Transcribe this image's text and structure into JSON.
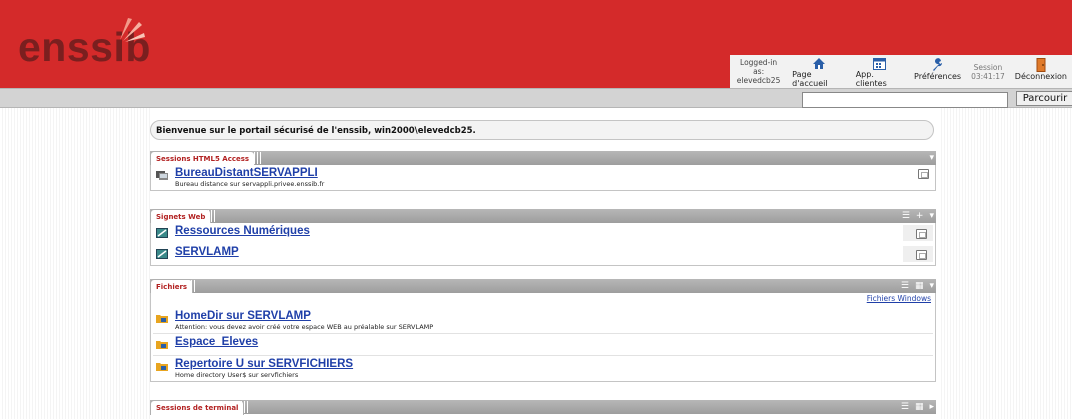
{
  "brand": {
    "logo_text": "enssib",
    "accent": "#d42a2a",
    "logo_color": "#7a1f1f"
  },
  "topnav": {
    "logged_in_label": "Logged-in as:",
    "username": "elevedcb25",
    "items": [
      {
        "label": "Page d'accueil",
        "icon": "home-icon"
      },
      {
        "label": "App. clientes",
        "icon": "apps-icon"
      },
      {
        "label": "Préférences",
        "icon": "wrench-icon"
      }
    ],
    "session_label": "Session",
    "session_time": "03:41:17",
    "logout_label": "Déconnexion"
  },
  "search": {
    "value": "",
    "button_label": "Parcourir"
  },
  "welcome": "Bienvenue sur le portail sécurisé de l'enssib, win2000\\elevedcb25.",
  "sections": {
    "html5": {
      "title": "Sessions HTML5 Access",
      "items": [
        {
          "name": "BureauDistantSERVAPPLI",
          "desc": "Bureau distance sur servappli.privee.enssib.fr",
          "icon": "remote-desktop-icon"
        }
      ]
    },
    "web": {
      "title": "Signets Web",
      "items": [
        {
          "name": "Ressources Numériques",
          "icon": "web-bookmark-icon"
        },
        {
          "name": "SERVLAMP",
          "icon": "web-bookmark-icon"
        }
      ]
    },
    "files": {
      "title": "Fichiers",
      "link_label": "Fichiers Windows",
      "items": [
        {
          "name": "HomeDir sur SERVLAMP",
          "desc": "Attention: vous devez avoir créé votre espace WEB au préalable sur SERVLAMP",
          "icon": "folder-icon"
        },
        {
          "name": "Espace_Eleves",
          "desc": "",
          "icon": "folder-icon"
        },
        {
          "name": "Repertoire U sur SERVFICHIERS",
          "desc": "Home directory User$ sur servfichiers",
          "icon": "folder-icon"
        }
      ]
    },
    "terminal": {
      "title": "Sessions de terminal"
    }
  }
}
